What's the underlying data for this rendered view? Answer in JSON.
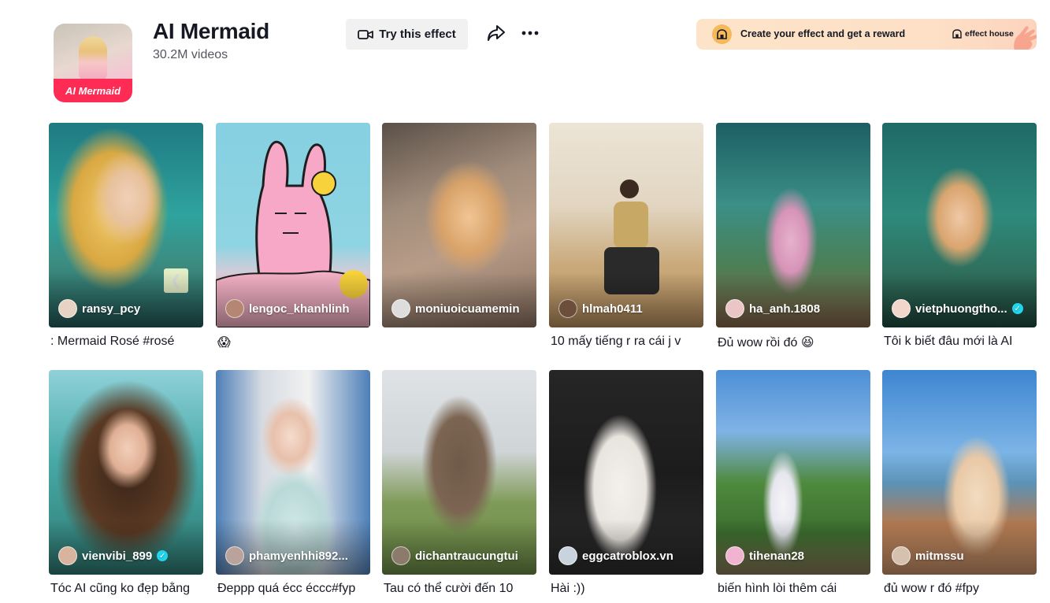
{
  "effect": {
    "thumb_label": "AI Mermaid",
    "title": "AI Mermaid",
    "video_count": "30.2M videos"
  },
  "actions": {
    "try_label": "Try this effect",
    "share_icon": "share-icon",
    "more_icon": "more-icon"
  },
  "banner": {
    "text": "Create your effect and get a reward",
    "brand": "effect house"
  },
  "videos": [
    {
      "user": "ransy_pcy",
      "caption": ": Mermaid Rosé #rosé",
      "verified": false
    },
    {
      "user": "lengoc_khanhlinh",
      "caption": "😱",
      "verified": false
    },
    {
      "user": "moniuoicuamemin",
      "caption": "",
      "verified": false
    },
    {
      "user": "hlmah0411",
      "caption": "10 mấy tiếng r ra cái j v",
      "verified": false
    },
    {
      "user": "ha_anh.1808",
      "caption": "Đủ wow rồi đó 😆",
      "verified": false
    },
    {
      "user": "vietphuongtho...",
      "caption": "Tôi k biết đâu mới là AI",
      "verified": true
    },
    {
      "user": "vienvibi_899",
      "caption": "Tóc AI cũng ko đẹp bằng",
      "verified": true
    },
    {
      "user": "phamyenhhi892...",
      "caption": "Đeppp quá écc éccc#fyp",
      "verified": false
    },
    {
      "user": "dichantraucungtui",
      "caption": "Tau có thể cười đến 10",
      "verified": false
    },
    {
      "user": "eggcatroblox.vn",
      "caption": "Hài :))",
      "verified": false
    },
    {
      "user": "tihenan28",
      "caption": "biến hình lòi thêm cái",
      "verified": false
    },
    {
      "user": "mitmssu",
      "caption": "đủ wow r đó #fpy",
      "verified": false
    }
  ]
}
